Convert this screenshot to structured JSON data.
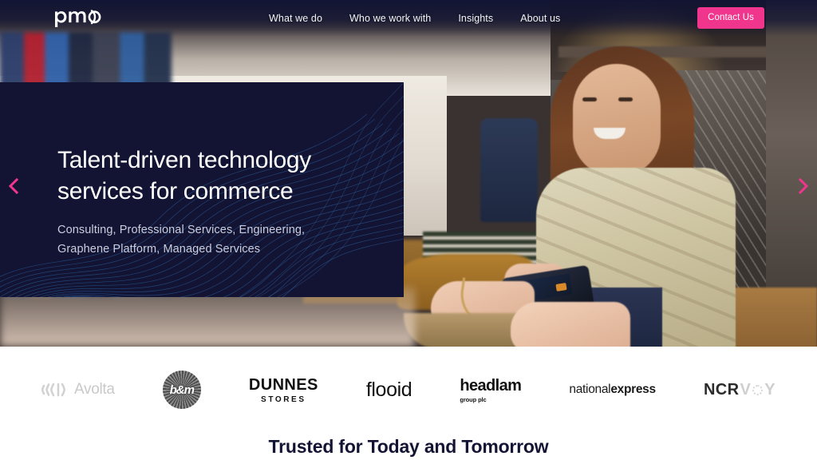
{
  "brand": {
    "logo_alt": "pmc",
    "accent_pink": "#f0358c",
    "panel_navy": "#131434"
  },
  "header": {
    "nav": [
      {
        "label": "What we do"
      },
      {
        "label": "Who we work with"
      },
      {
        "label": "Insights"
      },
      {
        "label": "About us"
      }
    ],
    "cta_label": "Contact Us"
  },
  "hero": {
    "headline": "Talent-driven technology\nservices for commerce",
    "subline": "Consulting, Professional Services, Engineering,\nGraphene Platform, Managed Services",
    "prev_icon": "chevron-left-icon",
    "next_icon": "chevron-right-icon"
  },
  "logo_strip": {
    "brands": [
      {
        "name": "Avolta",
        "text": "Avolta"
      },
      {
        "name": "B&M",
        "text": "b&m"
      },
      {
        "name": "Dunnes Stores",
        "line1": "DUNNES",
        "line2": "STORES"
      },
      {
        "name": "Flooid",
        "text": "flooid"
      },
      {
        "name": "Headlam Group plc",
        "line1": "headlam",
        "line2": "group plc"
      },
      {
        "name": "National Express",
        "word1": "national",
        "word2": "express"
      },
      {
        "name": "NCR Voyix",
        "part1": "NCR",
        "part2": "V",
        "part3": "Y"
      }
    ]
  },
  "trusted": {
    "title": "Trusted for Today and Tomorrow"
  }
}
